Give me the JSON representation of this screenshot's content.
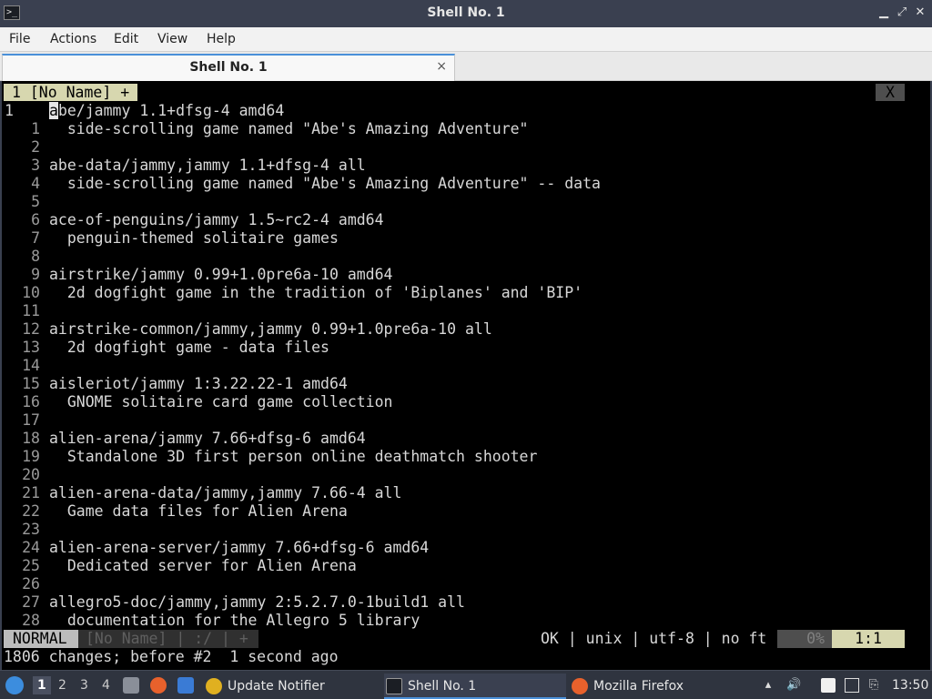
{
  "window": {
    "title": "Shell No. 1",
    "icon": "terminal-icon",
    "controls": [
      "minimize-icon",
      "maximize-icon",
      "close-icon"
    ]
  },
  "menu": [
    "File",
    "Actions",
    "Edit",
    "View",
    "Help"
  ],
  "tab": {
    "label": "Shell No. 1",
    "close": "×"
  },
  "vim": {
    "tabline": {
      "tab": "1 [No Name] +",
      "close": "X"
    },
    "current_line_number": "1",
    "lines": [
      {
        "n": "",
        "t": "abe/jammy 1.1+dfsg-4 amd64"
      },
      {
        "n": "1",
        "t": "  side-scrolling game named \"Abe's Amazing Adventure\""
      },
      {
        "n": "2",
        "t": ""
      },
      {
        "n": "3",
        "t": "abe-data/jammy,jammy 1.1+dfsg-4 all"
      },
      {
        "n": "4",
        "t": "  side-scrolling game named \"Abe's Amazing Adventure\" -- data"
      },
      {
        "n": "5",
        "t": ""
      },
      {
        "n": "6",
        "t": "ace-of-penguins/jammy 1.5~rc2-4 amd64"
      },
      {
        "n": "7",
        "t": "  penguin-themed solitaire games"
      },
      {
        "n": "8",
        "t": ""
      },
      {
        "n": "9",
        "t": "airstrike/jammy 0.99+1.0pre6a-10 amd64"
      },
      {
        "n": "10",
        "t": "  2d dogfight game in the tradition of 'Biplanes' and 'BIP'"
      },
      {
        "n": "11",
        "t": ""
      },
      {
        "n": "12",
        "t": "airstrike-common/jammy,jammy 0.99+1.0pre6a-10 all"
      },
      {
        "n": "13",
        "t": "  2d dogfight game - data files"
      },
      {
        "n": "14",
        "t": ""
      },
      {
        "n": "15",
        "t": "aisleriot/jammy 1:3.22.22-1 amd64"
      },
      {
        "n": "16",
        "t": "  GNOME solitaire card game collection"
      },
      {
        "n": "17",
        "t": ""
      },
      {
        "n": "18",
        "t": "alien-arena/jammy 7.66+dfsg-6 amd64"
      },
      {
        "n": "19",
        "t": "  Standalone 3D first person online deathmatch shooter"
      },
      {
        "n": "20",
        "t": ""
      },
      {
        "n": "21",
        "t": "alien-arena-data/jammy,jammy 7.66-4 all"
      },
      {
        "n": "22",
        "t": "  Game data files for Alien Arena"
      },
      {
        "n": "23",
        "t": ""
      },
      {
        "n": "24",
        "t": "alien-arena-server/jammy 7.66+dfsg-6 amd64"
      },
      {
        "n": "25",
        "t": "  Dedicated server for Alien Arena"
      },
      {
        "n": "26",
        "t": ""
      },
      {
        "n": "27",
        "t": "allegro5-doc/jammy,jammy 2:5.2.7.0-1build1 all"
      },
      {
        "n": "28",
        "t": "  documentation for the Allegro 5 library"
      }
    ],
    "statusline": {
      "mode": "NORMAL",
      "file": "[No Name] | :/ | +",
      "info": "OK | unix | utf-8 | no ft",
      "percent": "0%",
      "position": "1:1"
    },
    "cmdline": "1806 changes; before #2  1 second ago"
  },
  "taskbar": {
    "workspaces": [
      "1",
      "2",
      "3",
      "4"
    ],
    "tasks": [
      {
        "label": "Update Notifier",
        "icon": "update-notifier-icon"
      },
      {
        "label": "Shell No. 1",
        "icon": "terminal-icon"
      },
      {
        "label": "Mozilla Firefox",
        "icon": "firefox-icon"
      }
    ],
    "clock": "13:50"
  }
}
